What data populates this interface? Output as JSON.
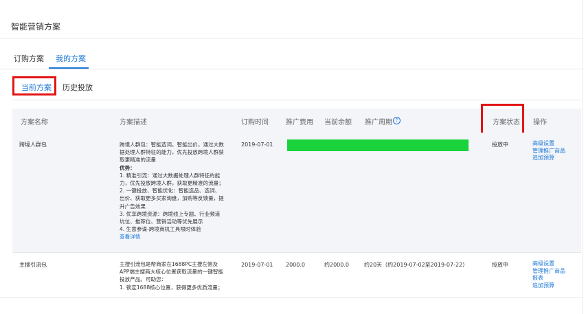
{
  "page": {
    "title": "智能营销方案"
  },
  "tabs": {
    "order": "订购方案",
    "mine": "我的方案"
  },
  "subtabs": {
    "current": "当前方案",
    "history": "历史投放"
  },
  "table": {
    "headers": {
      "name": "方案名称",
      "desc": "方案描述",
      "order_time": "订购时间",
      "cost": "推广费用",
      "balance": "当前余额",
      "period": "推广周期",
      "status": "方案状态",
      "ops": "操作"
    },
    "help_glyph": "?",
    "rows": [
      {
        "name": "跨境人群包",
        "desc_lines": [
          "跨境人群包：智能选词，智能出价，通过大数",
          "据处理人群特征的能力，优先投放跨境人群获",
          "取更精准的流量"
        ],
        "advantage_label": "优势：",
        "adv_lines": [
          "1. 精准引流：通过大数据处理人群特征的能",
          "力，优先投放跨境人群，获取更精准的流量；",
          "2. 一键投放、智能优化：智能选品、选词、",
          "出价、获取更多买家询盘，加购等反馈量，提",
          "升广告效果",
          "3. 优享跨境资源：跨境线上专题、行业频道",
          "坑位、推荐位、营销活动等优先展示",
          "4. 生意参谋-跨境商机工具限时体验"
        ],
        "details_link": "查看详情",
        "order_time": "2019-07-01",
        "status": "投放中",
        "ops": [
          "高级设置",
          "管理推广商品",
          "追加预算"
        ]
      },
      {
        "name": "主搜引流包",
        "desc_lines": [
          "主搜引流包是帮商家在1688PC主搜左侧及",
          "APP端主搜两大核心位置获取流量的一键智能",
          "投放产品。可助您：",
          "1. 锁定1688核心位置，获得更多优质流量；"
        ],
        "order_time": "2019-07-01",
        "cost": "2000.0",
        "balance": "约2000.0",
        "period": "约20天（约2019-07-02至2019-07-22）",
        "status": "投放中",
        "ops": [
          "高级设置",
          "管理推广商品",
          "报表",
          "追加预算"
        ]
      }
    ]
  },
  "colors": {
    "accent": "#1a77d6",
    "highlight_red": "#e31414",
    "redaction_green": "#19d23c"
  }
}
